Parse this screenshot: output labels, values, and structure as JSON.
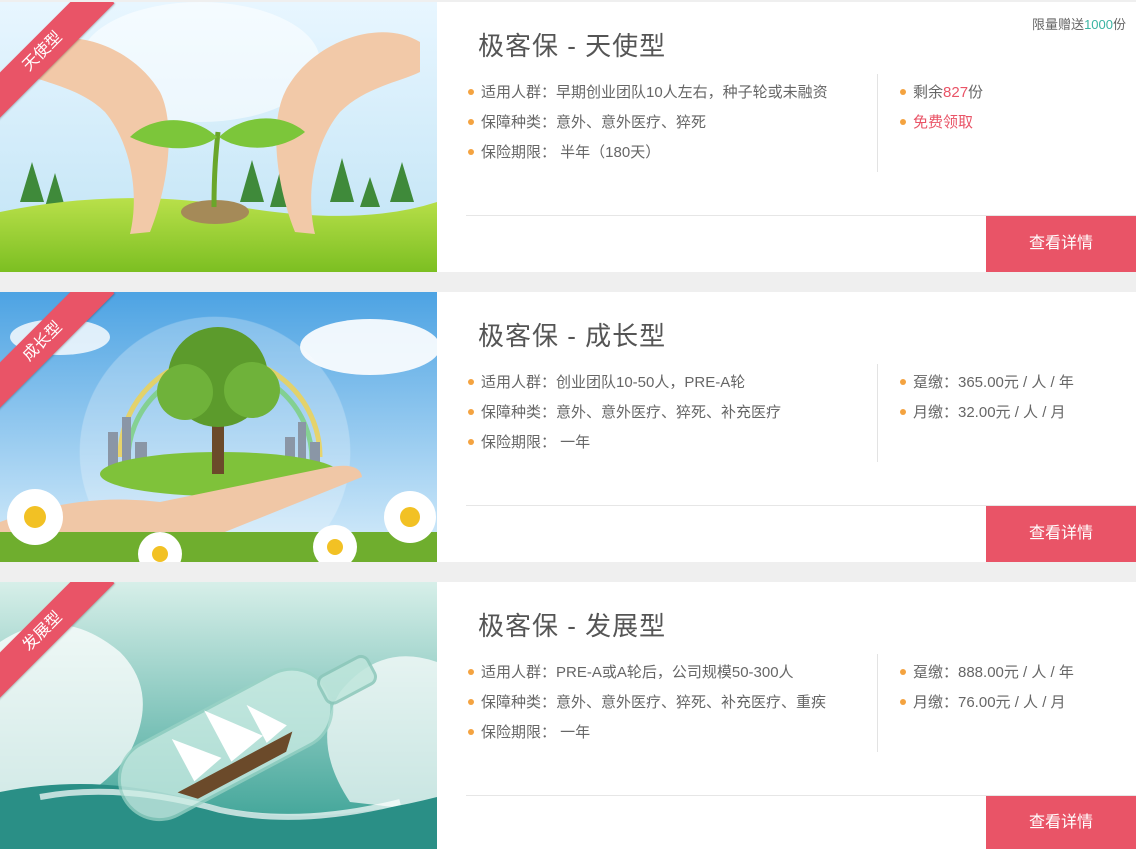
{
  "cards": [
    {
      "ribbon": "天使型",
      "title": "极客保 - 天使型",
      "quota_label": "限量赠送",
      "quota_num": "1000",
      "quota_unit": "份",
      "features": [
        "适用人群：早期创业团队10人左右，种子轮或未融资",
        "保障种类：意外、意外医疗、猝死",
        "保险期限： 半年（180天）"
      ],
      "remain_label": "剩余",
      "remain_num": "827",
      "remain_unit": "份",
      "free_label": "免费领取",
      "button": "查看详情"
    },
    {
      "ribbon": "成长型",
      "title": "极客保 - 成长型",
      "features": [
        "适用人群：创业团队10-50人，PRE-A轮",
        "保障种类：意外、意外医疗、猝死、补充医疗",
        "保险期限： 一年"
      ],
      "prices": [
        "趸缴：365.00元 / 人 / 年",
        "月缴：32.00元 / 人 / 月"
      ],
      "button": "查看详情"
    },
    {
      "ribbon": "发展型",
      "title": "极客保 - 发展型",
      "features": [
        "适用人群：PRE-A或A轮后，公司规模50-300人",
        "保障种类：意外、意外医疗、猝死、补充医疗、重疾",
        "保险期限： 一年"
      ],
      "prices": [
        "趸缴：888.00元 / 人 / 年",
        "月缴：76.00元 / 人 / 月"
      ],
      "button": "查看详情"
    }
  ],
  "colors": {
    "accent": "#e95467",
    "bullet": "#f4a340",
    "quota_number": "#3ab4a2"
  }
}
